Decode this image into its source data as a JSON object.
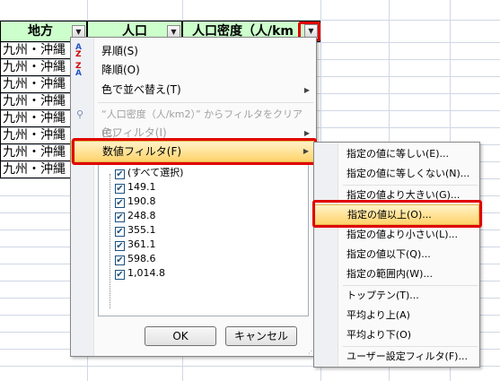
{
  "sheet": {
    "headers": [
      {
        "label": "地方"
      },
      {
        "label": "人口"
      },
      {
        "label": "人口密度（人/km"
      }
    ],
    "rows": [
      "九州・沖縄",
      "九州・沖縄",
      "九州・沖縄",
      "九州・沖縄",
      "九州・沖縄",
      "九州・沖縄",
      "九州・沖縄",
      "九州・沖縄"
    ]
  },
  "menu": {
    "sort_asc": "昇順(S)",
    "sort_desc": "降順(O)",
    "sort_by_color": "色で並べ替え(T)",
    "clear_filter": "“人口密度（人/km2）” からフィルタをクリア(C)",
    "color_filter": "色フィルタ(I)",
    "number_filter": "数値フィルタ(F)",
    "list": [
      "(すべて選択)",
      "149.1",
      "190.8",
      "248.8",
      "355.1",
      "361.1",
      "598.6",
      "1,014.8"
    ],
    "ok": "OK",
    "cancel": "キャンセル"
  },
  "submenu": {
    "items": [
      "指定の値に等しい(E)...",
      "指定の値に等しくない(N)...",
      "指定の値より大きい(G)...",
      "指定の値以上(O)...",
      "指定の値より小さい(L)...",
      "指定の値以下(Q)...",
      "指定の範囲内(W)...",
      "トップテン(T)...",
      "平均より上(A)",
      "平均より下(O)",
      "ユーザー設定フィルタ(F)..."
    ]
  }
}
